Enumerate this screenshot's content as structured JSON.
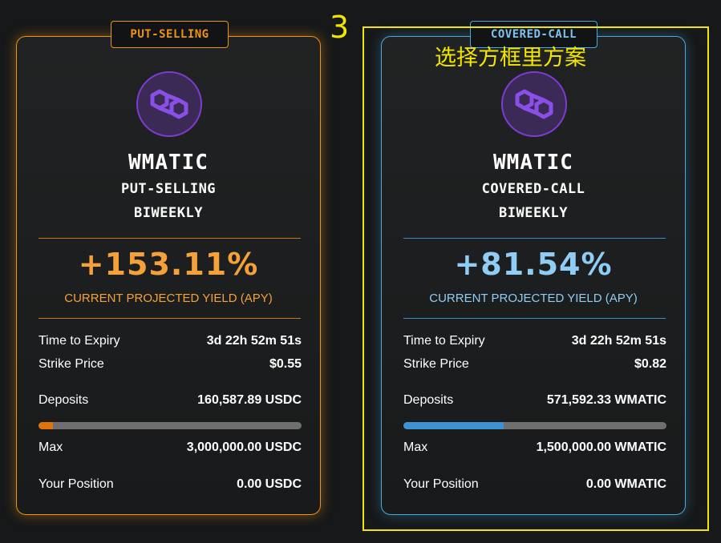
{
  "annotation": {
    "number": "3",
    "text": "选择方框里方案",
    "color": "#f2e600"
  },
  "cards": [
    {
      "tag": "PUT-SELLING",
      "logo_icon": "polygon-icon",
      "asset": "WMATIC",
      "strategy": "PUT-SELLING",
      "period": "BIWEEKLY",
      "apy": "+153.11%",
      "apy_label": "CURRENT PROJECTED YIELD (APY)",
      "time_to_expiry_label": "Time to Expiry",
      "time_to_expiry": "3d 22h 52m 51s",
      "strike_label": "Strike Price",
      "strike": "$0.55",
      "deposits_label": "Deposits",
      "deposits": "160,587.89 USDC",
      "deposit_progress": 0.054,
      "max_label": "Max",
      "max": "3,000,000.00 USDC",
      "position_label": "Your Position",
      "position": "0.00 USDC",
      "accent": "#f0930f"
    },
    {
      "tag": "COVERED-CALL",
      "logo_icon": "polygon-icon",
      "asset": "WMATIC",
      "strategy": "COVERED-CALL",
      "period": "BIWEEKLY",
      "apy": "+81.54%",
      "apy_label": "CURRENT PROJECTED YIELD (APY)",
      "time_to_expiry_label": "Time to Expiry",
      "time_to_expiry": "3d 22h 52m 51s",
      "strike_label": "Strike Price",
      "strike": "$0.82",
      "deposits_label": "Deposits",
      "deposits": "571,592.33 WMATIC",
      "deposit_progress": 0.381,
      "max_label": "Max",
      "max": "1,500,000.00 WMATIC",
      "position_label": "Your Position",
      "position": "0.00 WMATIC",
      "accent": "#4aa8e0"
    }
  ]
}
